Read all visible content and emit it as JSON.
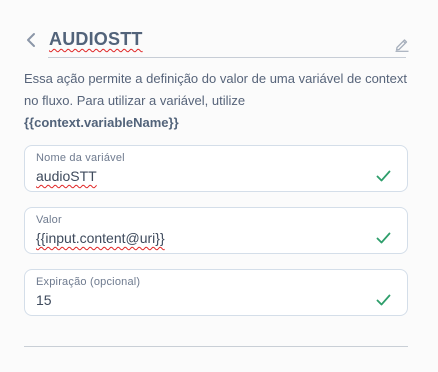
{
  "header": {
    "title": "AUDIOSTT",
    "back_icon": "chevron-left-icon",
    "edit_icon": "pencil-icon"
  },
  "description": {
    "text": "Essa ação permite a definição do valor de uma variável de context no fluxo. Para utilizar a variável, utilize",
    "variable": "{{context.variableName}}"
  },
  "fields": [
    {
      "label": "Nome da variável",
      "value": "audioSTT",
      "valid": true
    },
    {
      "label": "Valor",
      "value": "{{input.content@uri}}",
      "valid": true
    },
    {
      "label": "Expiração (opcional)",
      "value": "15",
      "valid": true
    }
  ],
  "colors": {
    "check": "#2e9e6b",
    "text": "#505f79",
    "border": "#d4dee9",
    "spellcheck": "#e02424"
  }
}
